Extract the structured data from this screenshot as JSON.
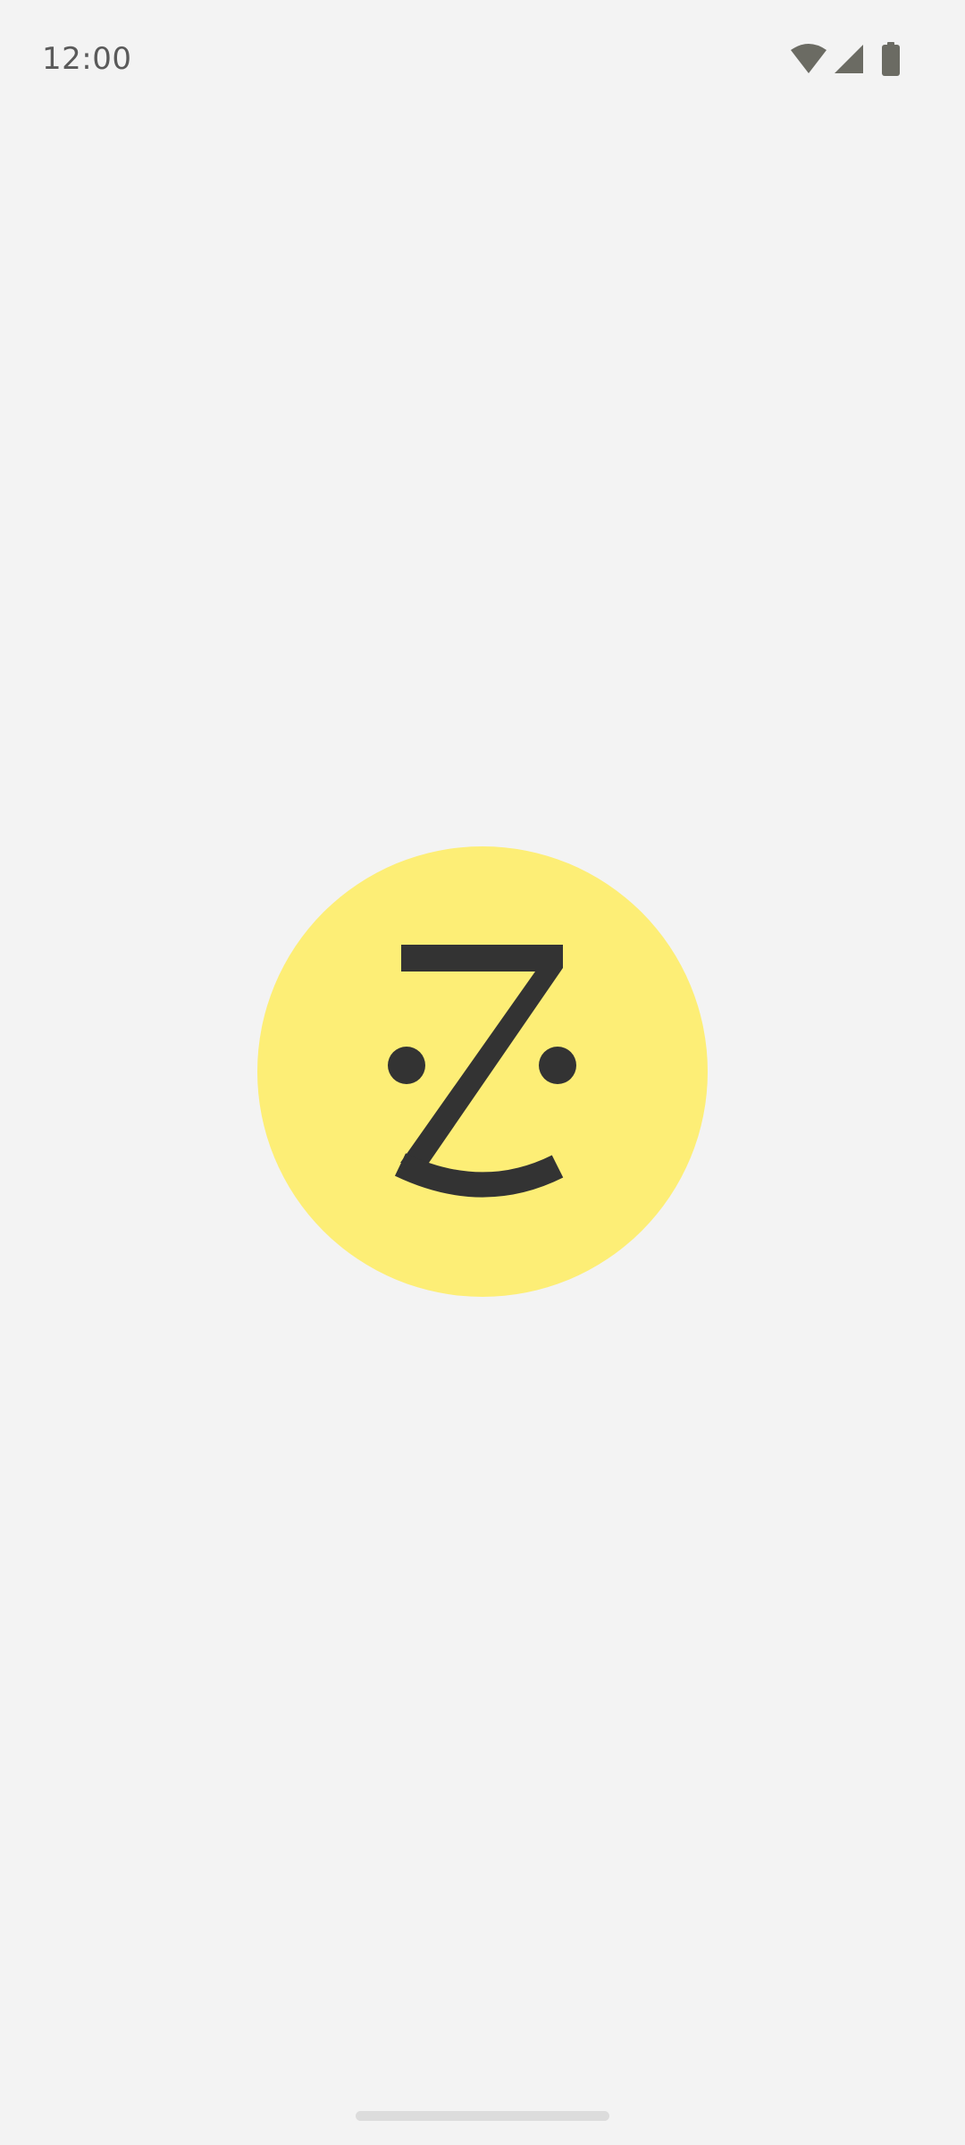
{
  "status_bar": {
    "time": "12:00",
    "icons": [
      "wifi-icon",
      "cellular-signal-icon",
      "battery-icon"
    ],
    "icon_color": "#6b6b63"
  },
  "splash": {
    "logo": "zillow-smile-logo-icon",
    "logo_bg_color": "#fdee76",
    "logo_fg_color": "#333333"
  },
  "navigation": {
    "gesture_bar_color": "#dcdcdc"
  },
  "background_color": "#f3f3f3"
}
